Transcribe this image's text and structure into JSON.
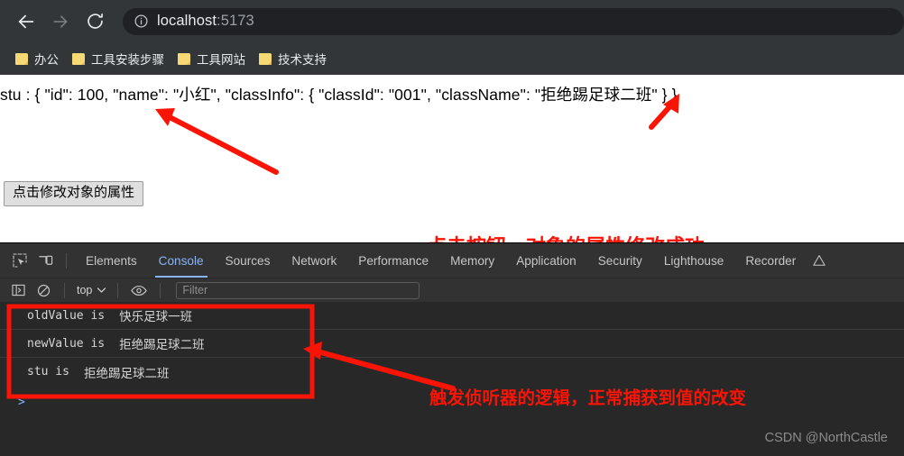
{
  "browser": {
    "nav": {
      "back_icon": "arrow-left-icon",
      "forward_icon": "arrow-right-icon",
      "reload_icon": "reload-icon"
    },
    "omnibox": {
      "site_info_icon": "info-circle-icon",
      "host": "localhost",
      "port": ":5173",
      "full_url": "localhost:5173"
    },
    "bookmarks": [
      {
        "label": "办公",
        "icon": "folder-icon"
      },
      {
        "label": "工具安装步骤",
        "icon": "folder-icon"
      },
      {
        "label": "工具网站",
        "icon": "folder-icon"
      },
      {
        "label": "技术支持",
        "icon": "folder-icon"
      }
    ]
  },
  "page": {
    "stu_line": "stu : { \"id\": 100, \"name\": \"小红\", \"classInfo\": { \"classId\": \"001\", \"className\": \"拒绝踢足球二班\" } }",
    "button_label": "点击修改对象的属性",
    "annotation": "点击按钮，对象的属性修改成功"
  },
  "devtools": {
    "icons": {
      "inspect": "inspect-element-icon",
      "device": "device-toolbar-icon",
      "sidebar": "console-sidebar-icon",
      "clear": "clear-console-icon",
      "eye": "live-expression-eye-icon",
      "chevron": "chevron-down-icon",
      "settings_warning": "warning-icon"
    },
    "tabs": [
      {
        "label": "Elements",
        "active": false
      },
      {
        "label": "Console",
        "active": true
      },
      {
        "label": "Sources",
        "active": false
      },
      {
        "label": "Network",
        "active": false
      },
      {
        "label": "Performance",
        "active": false
      },
      {
        "label": "Memory",
        "active": false
      },
      {
        "label": "Application",
        "active": false
      },
      {
        "label": "Security",
        "active": false
      },
      {
        "label": "Lighthouse",
        "active": false
      },
      {
        "label": "Recorder",
        "active": false
      }
    ],
    "toolbar": {
      "context": "top",
      "filter_placeholder": "Filter"
    },
    "console_rows": [
      {
        "label": "oldValue is",
        "value": "快乐足球一班"
      },
      {
        "label": "newValue is",
        "value": "拒绝踢足球二班"
      },
      {
        "label": "stu is",
        "value": "拒绝踢足球二班"
      }
    ],
    "prompt": ">",
    "annotation": "触发侦听器的逻辑，正常捕获到值的改变"
  },
  "watermark": "CSDN @NorthCastle",
  "colors": {
    "annotation_red": "#fa1405",
    "chrome_bg": "#323639",
    "omnibox_bg": "#202124",
    "devtools_bg": "#282828",
    "devtools_tabbar_bg": "#323232",
    "tab_active": "#8ab4f8",
    "folder_yellow": "#f8d775"
  }
}
